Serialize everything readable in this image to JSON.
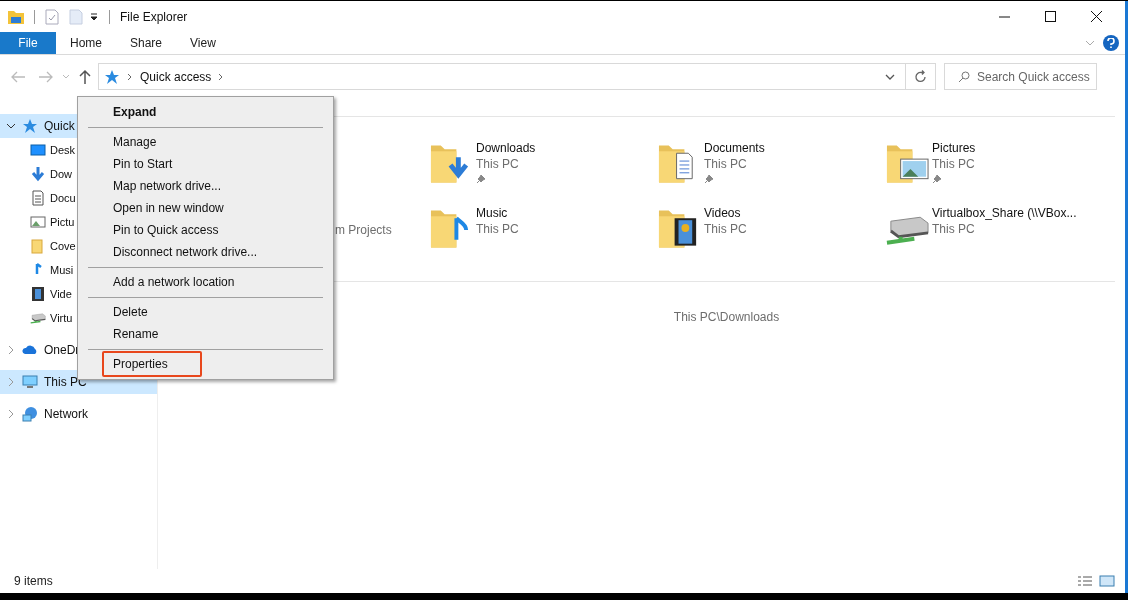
{
  "window": {
    "title": "File Explorer"
  },
  "ribbon": {
    "tabs": [
      {
        "label": "File",
        "selected": true
      },
      {
        "label": "Home",
        "selected": false
      },
      {
        "label": "Share",
        "selected": false
      },
      {
        "label": "View",
        "selected": false
      }
    ]
  },
  "address": {
    "path": [
      {
        "label": "Quick access"
      }
    ],
    "search": {
      "placeholder": "Search Quick access"
    }
  },
  "sidebar": {
    "items": [
      {
        "label": "Quick",
        "kind": "star",
        "selected": true,
        "expanded": true,
        "children": [
          {
            "label": "Desk",
            "kind": "desktop"
          },
          {
            "label": "Dow",
            "kind": "download"
          },
          {
            "label": "Docu",
            "kind": "document"
          },
          {
            "label": "Pictu",
            "kind": "picture"
          },
          {
            "label": "Cove",
            "kind": "folder"
          },
          {
            "label": "Musi",
            "kind": "music"
          },
          {
            "label": "Vide",
            "kind": "video"
          },
          {
            "label": "Virtu",
            "kind": "drive"
          }
        ]
      },
      {
        "label": "OneDr",
        "kind": "cloud",
        "selected": false,
        "expanded": false
      },
      {
        "label": "This PC",
        "kind": "pc",
        "selected": true,
        "expanded": false
      },
      {
        "label": "Network",
        "kind": "network",
        "selected": false,
        "expanded": false
      }
    ]
  },
  "folders": [
    {
      "kind": "download",
      "name": "Downloads",
      "subtitle": "This PC",
      "pinned": true
    },
    {
      "kind": "document",
      "name": "Documents",
      "subtitle": "This PC",
      "pinned": true
    },
    {
      "kind": "picture",
      "name": "Pictures",
      "subtitle": "This PC",
      "pinned": true
    },
    {
      "kind": "fragment",
      "subtitle": "m Projects"
    },
    {
      "kind": "music",
      "name": "Music",
      "subtitle": "This PC",
      "pinned": false
    },
    {
      "kind": "video",
      "name": "Videos",
      "subtitle": "This PC",
      "pinned": false
    },
    {
      "kind": "drive",
      "name": "Virtualbox_Share (\\\\VBox...",
      "subtitle": "This PC",
      "pinned": false
    }
  ],
  "recent": {
    "text": "This PC\\Downloads"
  },
  "context_menu": {
    "items": [
      {
        "kind": "item",
        "label": "Expand",
        "default": true,
        "outlined": false
      },
      {
        "kind": "separator"
      },
      {
        "kind": "item",
        "label": "Manage",
        "default": false,
        "outlined": false
      },
      {
        "kind": "item",
        "label": "Pin to Start",
        "default": false,
        "outlined": false
      },
      {
        "kind": "item",
        "label": "Map network drive...",
        "default": false,
        "outlined": false
      },
      {
        "kind": "item",
        "label": "Open in new window",
        "default": false,
        "outlined": false
      },
      {
        "kind": "item",
        "label": "Pin to Quick access",
        "default": false,
        "outlined": false
      },
      {
        "kind": "item",
        "label": "Disconnect network drive...",
        "default": false,
        "outlined": false
      },
      {
        "kind": "separator"
      },
      {
        "kind": "item",
        "label": "Add a network location",
        "default": false,
        "outlined": false
      },
      {
        "kind": "separator"
      },
      {
        "kind": "item",
        "label": "Delete",
        "default": false,
        "outlined": false
      },
      {
        "kind": "item",
        "label": "Rename",
        "default": false,
        "outlined": false
      },
      {
        "kind": "separator"
      },
      {
        "kind": "item",
        "label": "Properties",
        "default": false,
        "outlined": true
      }
    ]
  },
  "status_bar": {
    "text": "9 items"
  }
}
